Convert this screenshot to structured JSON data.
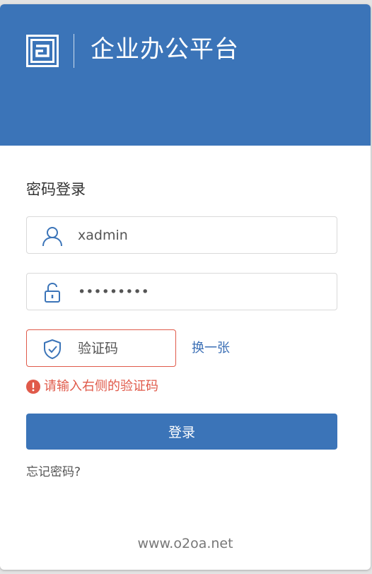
{
  "header": {
    "title": "企业办公平台",
    "logo_icon": "o2-logo-icon",
    "background_color": "#3b74b8"
  },
  "login": {
    "title": "密码登录",
    "username": {
      "value": "xadmin",
      "icon": "user-icon"
    },
    "password": {
      "value": "123456789",
      "icon": "unlock-icon"
    },
    "captcha": {
      "placeholder": "验证码",
      "icon": "shield-check-icon",
      "refresh_label": "换一张"
    },
    "error": {
      "message": "请输入右侧的验证码",
      "icon": "exclamation-circle-icon",
      "color": "#e05a4a"
    },
    "submit_label": "登录",
    "forgot_label": "忘记密码?"
  },
  "footer": {
    "site": "www.o2oa.net"
  }
}
